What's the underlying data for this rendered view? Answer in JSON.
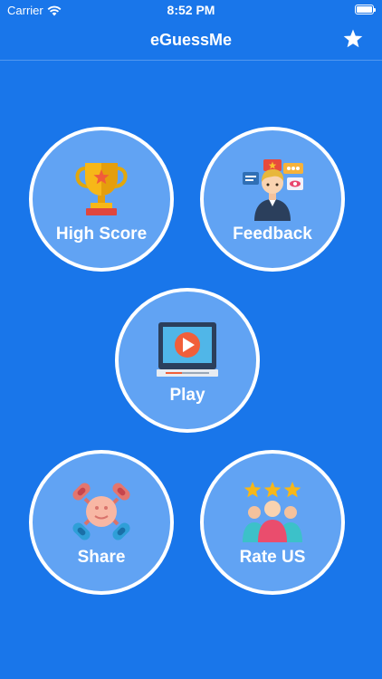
{
  "status_bar": {
    "carrier": "Carrier",
    "time": "8:52 PM"
  },
  "nav": {
    "title": "eGuessMe",
    "favorite_icon": "star-icon"
  },
  "menu": {
    "high_score": {
      "label": "High Score",
      "icon": "trophy-icon"
    },
    "feedback": {
      "label": "Feedback",
      "icon": "feedback-person-icon"
    },
    "play": {
      "label": "Play",
      "icon": "video-play-icon"
    },
    "share": {
      "label": "Share",
      "icon": "share-network-icon"
    },
    "rate": {
      "label": "Rate US",
      "icon": "rate-users-icon"
    }
  },
  "colors": {
    "background": "#1976ea",
    "circle_fill": "#61a3f3",
    "circle_border": "#ffffff"
  }
}
